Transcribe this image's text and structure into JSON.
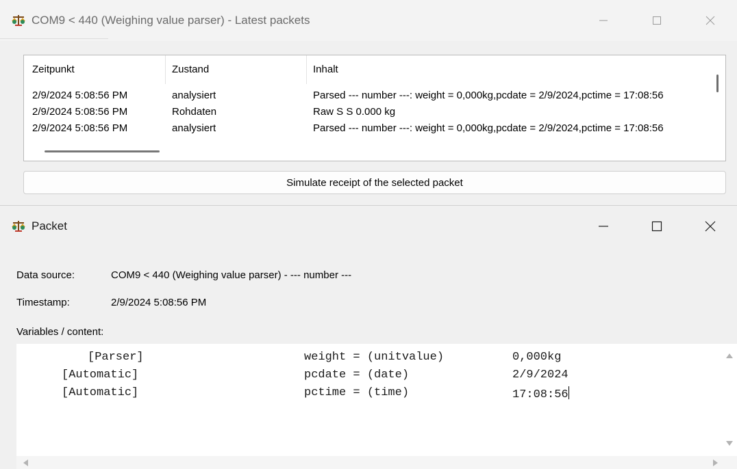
{
  "window_main": {
    "title": "COM9 < 440 (Weighing value parser) - Latest packets",
    "list": {
      "columns": [
        "Zeitpunkt",
        "Zustand",
        "Inhalt"
      ],
      "rows": [
        {
          "time": "2/9/2024 5:08:56 PM",
          "state": "analysiert",
          "content": "Parsed --- number ---: weight = 0,000kg,pcdate = 2/9/2024,pctime = 17:08:56"
        },
        {
          "time": "2/9/2024 5:08:56 PM",
          "state": "Rohdaten",
          "content": "Raw S S     0.000 kg"
        },
        {
          "time": "2/9/2024 5:08:56 PM",
          "state": "analysiert",
          "content": "Parsed --- number ---: weight = 0,000kg,pcdate = 2/9/2024,pctime = 17:08:56"
        }
      ]
    },
    "simulate_button": "Simulate receipt of the selected packet"
  },
  "window_packet": {
    "title": "Packet",
    "data_source_label": "Data source:",
    "data_source_value": "COM9 < 440 (Weighing value parser) - --- number ---",
    "timestamp_label": "Timestamp:",
    "timestamp_value": "2/9/2024 5:08:56 PM",
    "variables_label": "Variables / content:",
    "variables": [
      {
        "source": "[Parser]",
        "expr": "weight = (unitvalue)",
        "value": "0,000kg"
      },
      {
        "source": "[Automatic]",
        "expr": "pcdate = (date)",
        "value": "2/9/2024"
      },
      {
        "source": "[Automatic]",
        "expr": "pctime = (time)",
        "value": "17:08:56"
      }
    ]
  },
  "icons": {
    "app": "scale-icon",
    "minimize": "minimize-icon",
    "maximize": "maximize-icon",
    "close": "close-icon"
  },
  "colors": {
    "background": "#f0f0f0",
    "title_text_inactive": "#6b6b6b",
    "list_background": "#ffffff"
  }
}
